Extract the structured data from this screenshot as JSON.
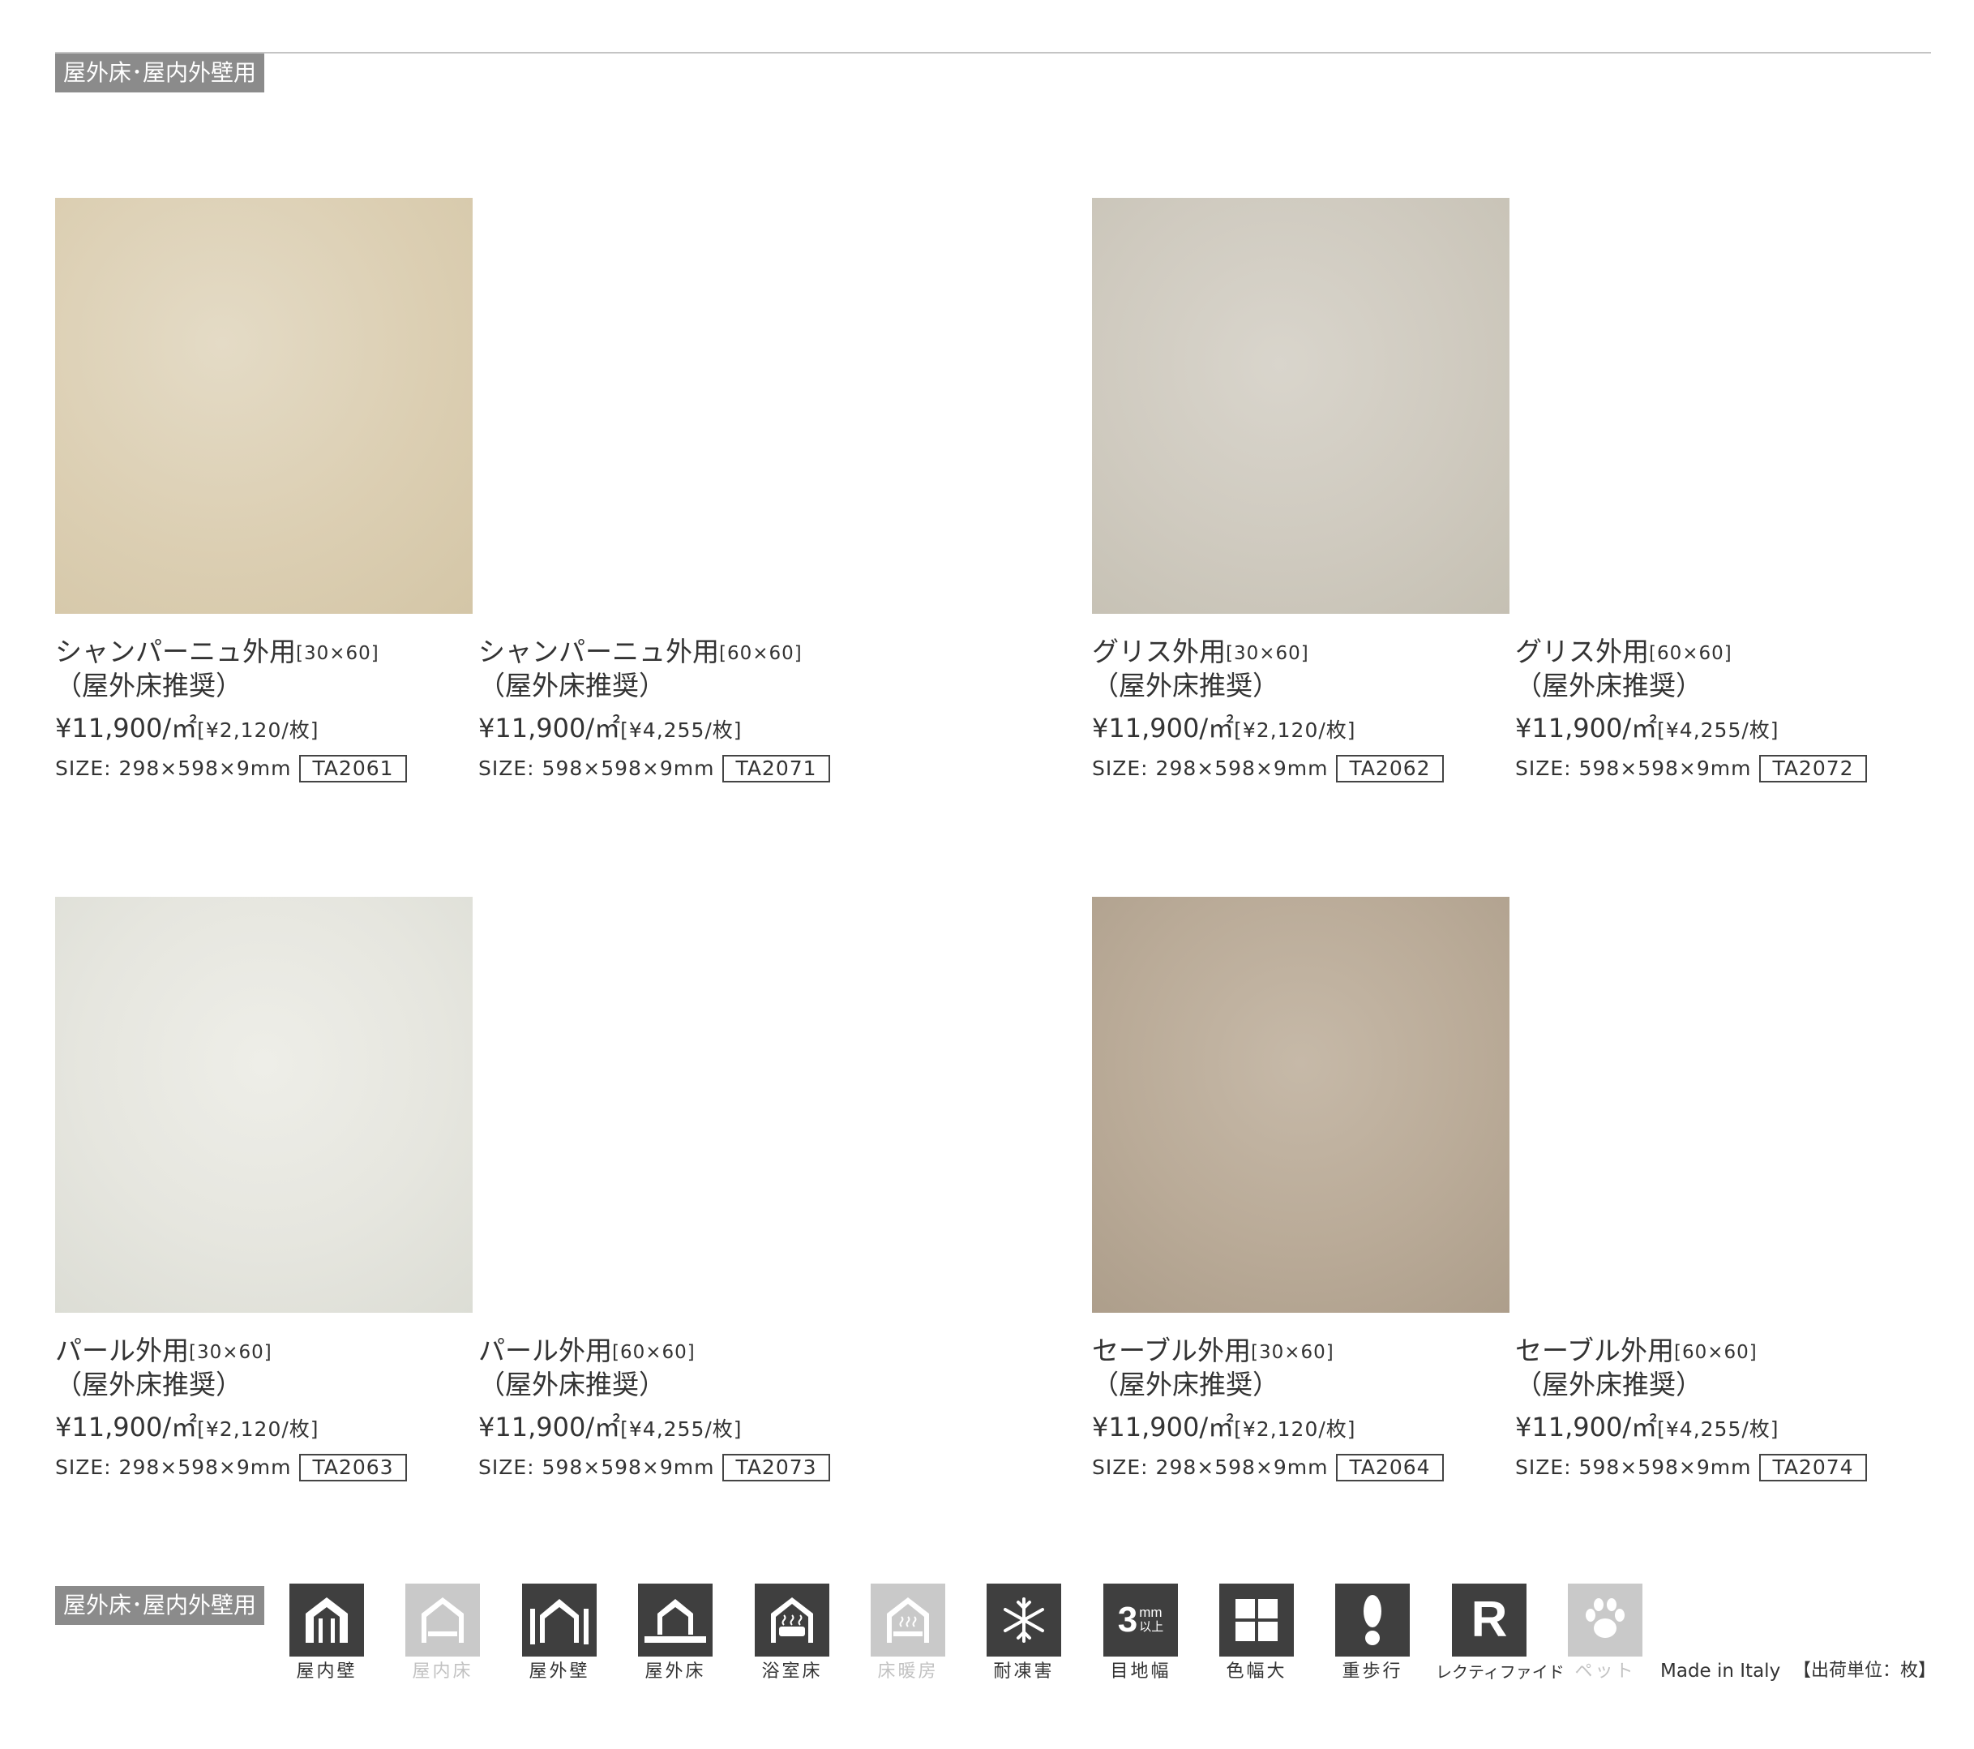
{
  "section_label": "屋外床･屋内外壁用",
  "products": [
    {
      "name": "シャンパーニュ外用",
      "size_tag": "[30×60]",
      "note": "（屋外床推奨）",
      "price": "¥11,900/㎡",
      "per_piece": "[¥2,120/枚]",
      "spec": "SIZE: 298×598×9mm",
      "code": "TA2061"
    },
    {
      "name": "シャンパーニュ外用",
      "size_tag": "[60×60]",
      "note": "（屋外床推奨）",
      "price": "¥11,900/㎡",
      "per_piece": "[¥4,255/枚]",
      "spec": "SIZE: 598×598×9mm",
      "code": "TA2071"
    },
    {
      "name": "グリス外用",
      "size_tag": "[30×60]",
      "note": "（屋外床推奨）",
      "price": "¥11,900/㎡",
      "per_piece": "[¥2,120/枚]",
      "spec": "SIZE: 298×598×9mm",
      "code": "TA2062"
    },
    {
      "name": "グリス外用",
      "size_tag": "[60×60]",
      "note": "（屋外床推奨）",
      "price": "¥11,900/㎡",
      "per_piece": "[¥4,255/枚]",
      "spec": "SIZE: 598×598×9mm",
      "code": "TA2072"
    },
    {
      "name": "パール外用",
      "size_tag": "[30×60]",
      "note": "（屋外床推奨）",
      "price": "¥11,900/㎡",
      "per_piece": "[¥2,120/枚]",
      "spec": "SIZE: 298×598×9mm",
      "code": "TA2063"
    },
    {
      "name": "パール外用",
      "size_tag": "[60×60]",
      "note": "（屋外床推奨）",
      "price": "¥11,900/㎡",
      "per_piece": "[¥4,255/枚]",
      "spec": "SIZE: 598×598×9mm",
      "code": "TA2073"
    },
    {
      "name": "セーブル外用",
      "size_tag": "[30×60]",
      "note": "（屋外床推奨）",
      "price": "¥11,900/㎡",
      "per_piece": "[¥2,120/枚]",
      "spec": "SIZE: 298×598×9mm",
      "code": "TA2064"
    },
    {
      "name": "セーブル外用",
      "size_tag": "[60×60]",
      "note": "（屋外床推奨）",
      "price": "¥11,900/㎡",
      "per_piece": "[¥4,255/枚]",
      "spec": "SIZE: 598×598×9mm",
      "code": "TA2074"
    }
  ],
  "swatch_colors": [
    "#dccfb3",
    "#cfcabf",
    "#e6e6df",
    "#baab98"
  ],
  "features": [
    {
      "label": "屋内壁",
      "icon": "indoor-wall-icon",
      "active": true
    },
    {
      "label": "屋内床",
      "icon": "indoor-floor-icon",
      "active": false
    },
    {
      "label": "屋外壁",
      "icon": "outdoor-wall-icon",
      "active": true
    },
    {
      "label": "屋外床",
      "icon": "outdoor-floor-icon",
      "active": true
    },
    {
      "label": "浴室床",
      "icon": "bathroom-floor-icon",
      "active": true
    },
    {
      "label": "床暖房",
      "icon": "floor-heating-icon",
      "active": false
    },
    {
      "label": "耐凍害",
      "icon": "snowflake-icon",
      "active": true
    },
    {
      "label": "目地幅",
      "icon": "joint-width-icon",
      "active": true,
      "icon_text": "3",
      "icon_sub_top": "mm",
      "icon_sub_bottom": "以上"
    },
    {
      "label": "色幅大",
      "icon": "color-variation-icon",
      "active": true
    },
    {
      "label": "重歩行",
      "icon": "footprint-icon",
      "active": true
    },
    {
      "label": "レクティファイド",
      "icon": "rectified-icon",
      "active": true,
      "icon_text": "R"
    },
    {
      "label": "ペット",
      "icon": "paw-icon",
      "active": false
    }
  ],
  "origin": "Made in Italy",
  "shipping_unit": "【出荷単位：枚】"
}
